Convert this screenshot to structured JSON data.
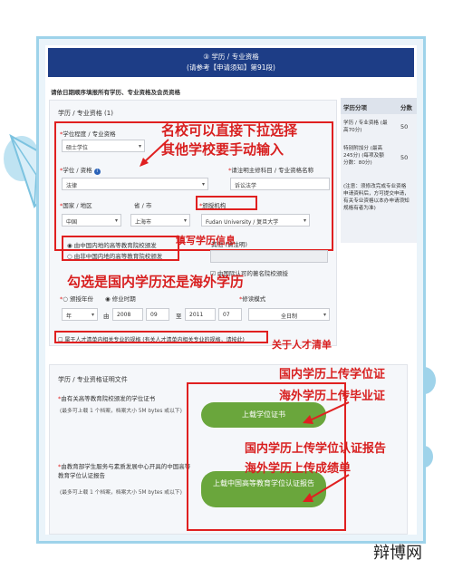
{
  "header": {
    "line1": "③ 学历 / 专业资格",
    "line2": "(请参考【申请须知】第91段)"
  },
  "intro": "请依日期顺序填报所有学历、专业资格及会员资格",
  "side_table": {
    "col1": "学历分项",
    "col2": "分数",
    "rows": [
      {
        "text": "学历 / 专业资格 (最高70分)",
        "score": "50"
      },
      {
        "text": "特别附加分 (最高245分) (每项及额分数：80分)",
        "score": "50"
      },
      {
        "text": "(注意：须修改完成专业资格申请资料后，方可提交申请，有关专业资格以本办申请须知规格有者为准)",
        "score": ""
      }
    ]
  },
  "section": {
    "title": "学历 / 专业资格 (1)",
    "level_label": "学位程度 / 专业资格",
    "level_value": "硕士学位",
    "degree_label": "学位 / 资格",
    "degree_value": "法律",
    "major_label": "请注明主修科目 / 专业资格名称",
    "major_value": "诉讼法学",
    "country_label": "国家 / 地区",
    "country_value": "中国",
    "city_label": "省 / 市",
    "city_value": "上海市",
    "institution_label": "颁授机构",
    "institution_value": "Fudan University / 复旦大学",
    "other_label": "其他 (请注明)",
    "radio1": "由中国内地的高等教育院校颁发",
    "radio2": "由非中国内地的高等教育院校颁发",
    "recognized": "由国际认可的著名院校颁授",
    "option_year": "颁授年份",
    "option_period": "修业时期",
    "year_value": "年",
    "from_label": "由",
    "from_year": "2008",
    "from_month": "09",
    "to_label": "至",
    "to_year": "2011",
    "to_month": "07",
    "mode_label": "修读模式",
    "mode_value": "全日制",
    "talent_check": "属于人才清单内相关专业的规格 (有关人才清单内相关专业的规格，请按此)"
  },
  "docs": {
    "title": "学历 / 专业资格证明文件",
    "item1_title": "由有关高等教育院校颁发的学位证书",
    "item1_hint": "(最多可上载 1 个档案，档案大小 5M bytes 或以下)",
    "item1_button": "上载学位证书",
    "item2_title": "由教育部学生服务与素质发展中心开具的中国高等教育学位认证报告",
    "item2_hint": "(最多可上载 1 个档案，档案大小 5M bytes 或以下)",
    "item2_button": "上载中国高等教育学位认证报告"
  },
  "annotations": {
    "select_tip_1": "名校可以直接下拉选择",
    "select_tip_2": "其他学校要手动输入",
    "fill_info": "填写学历信息",
    "domestic_tip": "勾选是国内学历还是海外学历",
    "talent_tip": "关于人才清单",
    "upload1_a": "国内学历上传学位证",
    "upload1_b": "海外学历上传毕业证",
    "upload2_a": "国内学历上传学位认证报告",
    "upload2_b": "海外学历上传成绩单"
  },
  "watermark": "辩博网",
  "colors": {
    "header_bg": "#1d3d86",
    "annotation_red": "#e02020",
    "button_green": "#6aa63c",
    "frame_blue": "#9ed3ea"
  }
}
